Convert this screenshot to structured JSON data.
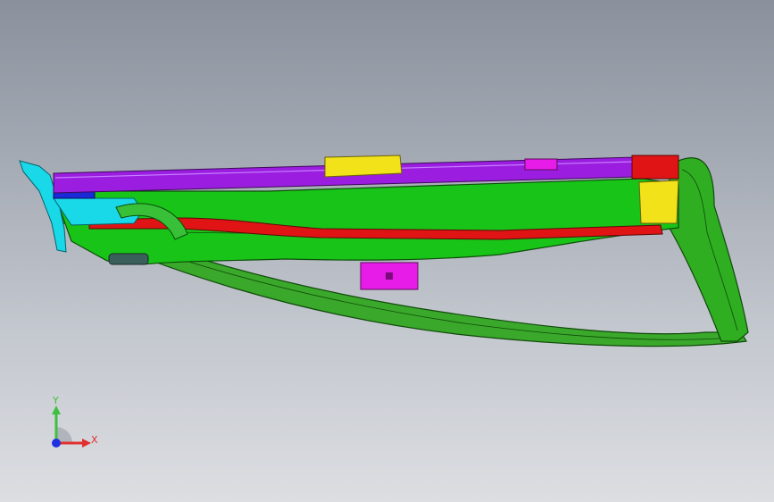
{
  "viewport": {
    "colors": {
      "background_top": "#8a919c",
      "background_bottom": "#dcdee2"
    }
  },
  "model": {
    "parts": [
      {
        "name": "purple-rod",
        "color": "#9b1ee0"
      },
      {
        "name": "green-housing",
        "color": "#1ec21e"
      },
      {
        "name": "red-rail",
        "color": "#e01414"
      },
      {
        "name": "yellow-clip",
        "color": "#f2e21a"
      },
      {
        "name": "magenta-block",
        "color": "#e81ce8"
      },
      {
        "name": "cyan-end-cap",
        "color": "#19d8e8"
      },
      {
        "name": "blue-insert",
        "color": "#1a2ad8"
      }
    ]
  },
  "triad": {
    "x_label": "X",
    "y_label": "Y",
    "colors": {
      "x": "#e03030",
      "y": "#3fbf3f",
      "z": "#2030e0"
    }
  }
}
